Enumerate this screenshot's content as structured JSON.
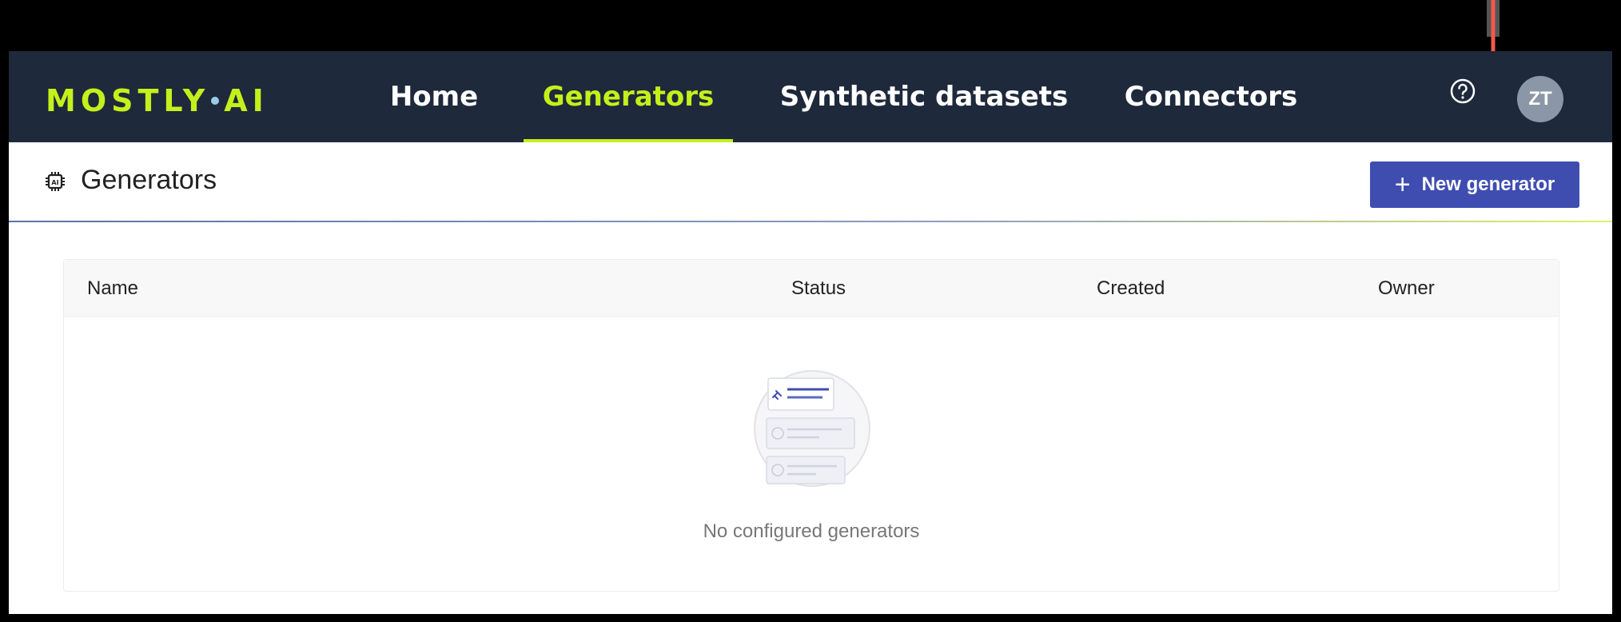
{
  "brand": {
    "logo_left": "MOSTLY",
    "logo_right": "AI"
  },
  "nav": {
    "items": [
      {
        "label": "Home"
      },
      {
        "label": "Generators"
      },
      {
        "label": "Synthetic datasets"
      },
      {
        "label": "Connectors"
      }
    ],
    "active": "Generators"
  },
  "user": {
    "initials": "ZT"
  },
  "page": {
    "title": "Generators"
  },
  "actions": {
    "new_generator": "New generator"
  },
  "table": {
    "columns": [
      "Name",
      "Status",
      "Created",
      "Owner"
    ],
    "empty_message": "No configured generators"
  },
  "colors": {
    "accent": "#c4f01b",
    "topbar": "#1e293b",
    "primary_button": "#3f4db0",
    "annotation_arrow": "#f05a4a"
  },
  "icons": {
    "help": "help-circle-icon",
    "page": "ai-chip-icon",
    "add": "plus-icon",
    "empty_state": "empty-list-illustration"
  }
}
